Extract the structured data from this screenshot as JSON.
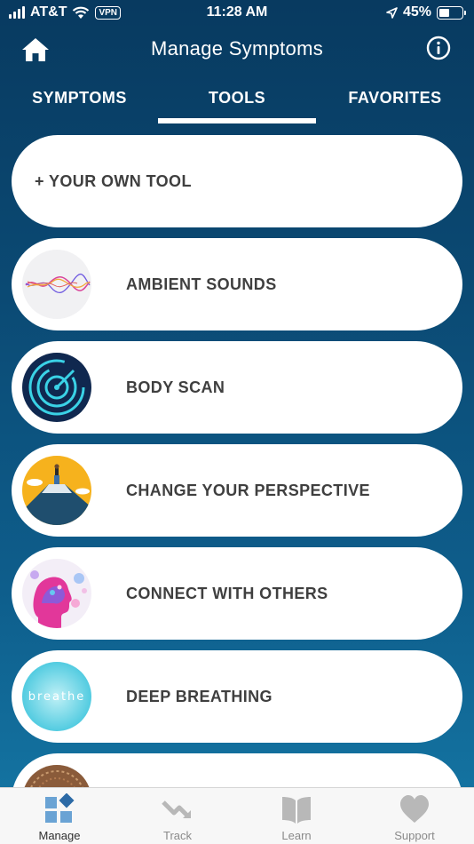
{
  "status_bar": {
    "carrier": "AT&T",
    "vpn": "VPN",
    "time": "11:28 AM",
    "battery": "45%",
    "battery_level": 0.45
  },
  "header": {
    "title": "Manage Symptoms",
    "home_icon": "home-icon",
    "info_icon": "info-icon"
  },
  "tabs": [
    {
      "label": "SYMPTOMS",
      "active": false
    },
    {
      "label": "TOOLS",
      "active": true
    },
    {
      "label": "FAVORITES",
      "active": false
    }
  ],
  "tools": [
    {
      "label": "+ YOUR OWN TOOL",
      "thumb": null
    },
    {
      "label": "AMBIENT SOUNDS",
      "thumb": "sound-wave-thumbnail"
    },
    {
      "label": "BODY SCAN",
      "thumb": "radar-thumbnail"
    },
    {
      "label": "CHANGE YOUR PERSPECTIVE",
      "thumb": "mountain-summit-thumbnail"
    },
    {
      "label": "CONNECT WITH OTHERS",
      "thumb": "head-profile-thumbnail"
    },
    {
      "label": "DEEP BREATHING",
      "thumb": "breathe-thumbnail",
      "thumb_text": "breathe"
    },
    {
      "label": "",
      "thumb": "partial-thumbnail"
    }
  ],
  "bottom_nav": [
    {
      "label": "Manage",
      "icon": "manage-icon",
      "active": true,
      "color": "#3a7fb8"
    },
    {
      "label": "Track",
      "icon": "track-icon",
      "active": false,
      "color": "#b8b8b8"
    },
    {
      "label": "Learn",
      "icon": "learn-icon",
      "active": false,
      "color": "#b8b8b8"
    },
    {
      "label": "Support",
      "icon": "support-icon",
      "active": false,
      "color": "#b8b8b8"
    }
  ],
  "colors": {
    "bg_top": "#083a60",
    "bg_bottom": "#1578a6",
    "card_text": "#3f3f3f",
    "active_nav": "#2f6fa8",
    "inactive_nav": "#8a8a8a"
  }
}
